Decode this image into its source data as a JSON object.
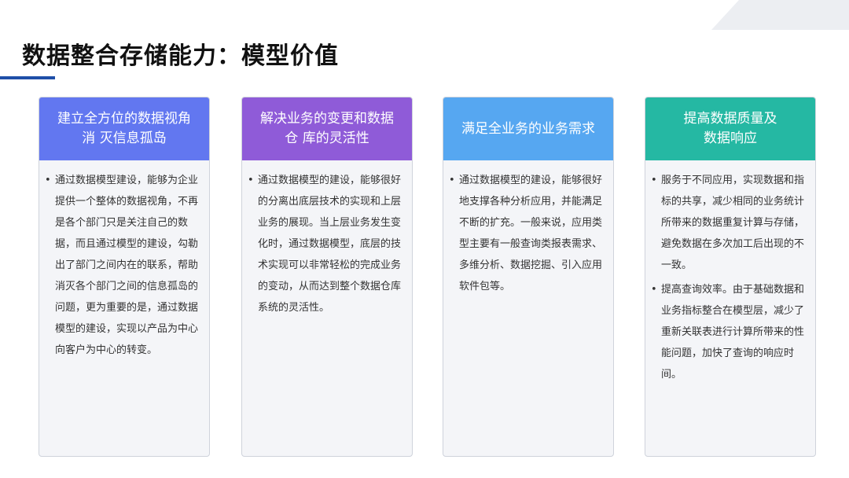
{
  "title": "数据整合存储能力：模型价值",
  "colors": {
    "accent": "#1f4fa8",
    "card1": "#6277f0",
    "card2": "#8f5bd8",
    "card3": "#56a7f1",
    "card4": "#25b8a3"
  },
  "cards": [
    {
      "header": "建立全方位的数据视角\n消 灭信息孤岛",
      "bullets": [
        "通过数据模型建设，能够为企业提供一个整体的数据视角，不再是各个部门只是关注自己的数据，而且通过模型的建设，勾勒出了部门之间内在的联系，帮助消灭各个部门之间的信息孤岛的问题，更为重要的是，通过数据模型的建设，实现以产品为中心向客户为中心的转变。"
      ]
    },
    {
      "header": "解决业务的变更和数据\n仓 库的灵活性",
      "bullets": [
        "通过数据模型的建设，能够很好的分离出底层技术的实现和上层业务的展现。当上层业务发生变化时，通过数据模型，底层的技术实现可以非常轻松的完成业务的变动，从而达到整个数据仓库系统的灵活性。"
      ]
    },
    {
      "header": "满足全业务的业务需求",
      "bullets": [
        "通过数据模型的建设，能够很好地支撑各种分析应用，并能满足不断的扩充。一般来说，应用类型主要有一般查询类报表需求、多维分析、数据挖掘、引入应用软件包等。"
      ]
    },
    {
      "header": "提高数据质量及\n数据响应",
      "bullets": [
        "服务于不同应用，实现数据和指标的共享，减少相同的业务统计所带来的数据重复计算与存储，避免数据在多次加工后出现的不一致。",
        "提高查询效率。由于基础数据和业务指标整合在模型层，减少了重新关联表进行计算所带来的性能问题，加快了查询的响应时间。"
      ]
    }
  ]
}
